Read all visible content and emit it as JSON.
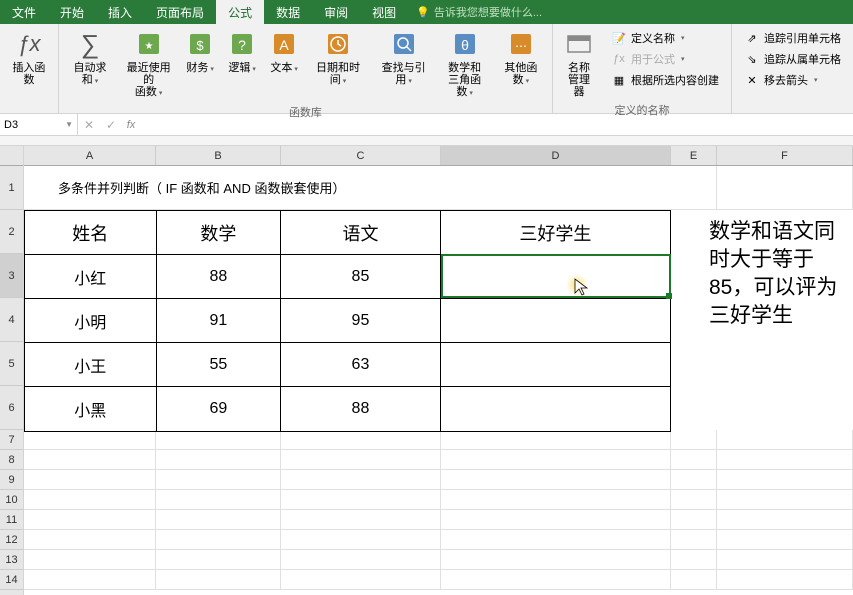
{
  "tabs": {
    "file": "文件",
    "home": "开始",
    "insert": "插入",
    "layout": "页面布局",
    "formulas": "公式",
    "data": "数据",
    "review": "审阅",
    "view": "视图"
  },
  "tell_me": "告诉我您想要做什么...",
  "ribbon": {
    "insert_function": "插入函数",
    "autosum": "自动求和",
    "recent": "最近使用的\n函数",
    "financial": "财务",
    "logical": "逻辑",
    "text": "文本",
    "datetime": "日期和时间",
    "lookup": "查找与引用",
    "math": "数学和\n三角函数",
    "more": "其他函数",
    "lib_label": "函数库",
    "name_mgr": "名称\n管理器",
    "define_name": "定义名称",
    "use_formula": "用于公式",
    "create_names": "根据所选内容创建",
    "names_label": "定义的名称",
    "trace_prec": "追踪引用单元格",
    "trace_dep": "追踪从属单元格",
    "remove_arrows": "移去箭头"
  },
  "namebox": "D3",
  "fx_label": "fx",
  "fx_icon": "ƒx",
  "columns": [
    "A",
    "B",
    "C",
    "D",
    "E",
    "F"
  ],
  "rows": [
    "1",
    "2",
    "3",
    "4",
    "5",
    "6",
    "7",
    "8",
    "9",
    "10",
    "11",
    "12",
    "13",
    "14"
  ],
  "title_text": "多条件并列判断（ IF 函数和 AND 函数嵌套使用）",
  "header": {
    "name": "姓名",
    "math": "数学",
    "chinese": "语文",
    "award": "三好学生"
  },
  "data_rows": [
    {
      "name": "小红",
      "math": "88",
      "chinese": "85"
    },
    {
      "name": "小明",
      "math": "91",
      "chinese": "95"
    },
    {
      "name": "小王",
      "math": "55",
      "chinese": "63"
    },
    {
      "name": "小黑",
      "math": "69",
      "chinese": "88"
    }
  ],
  "note": "数学和语文同时大于等于85，可以评为三好学生",
  "bulb_icon": "💡"
}
